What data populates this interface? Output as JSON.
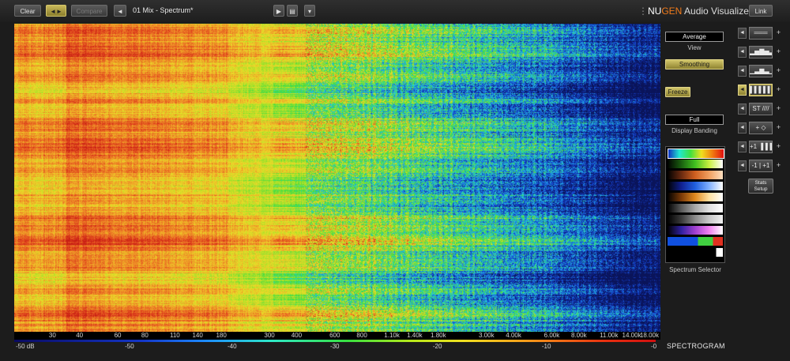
{
  "toolbar": {
    "clear_label": "Clear",
    "ab_label": "◄►",
    "compare_label": "Compare",
    "prev_label": "◄",
    "preset_name": "01 Mix - Spectrum*",
    "play_label": "▶",
    "save_label": "▤",
    "menu_label": "▾",
    "brand_nu": "NU",
    "brand_gen": "GEN",
    "brand_rest": " Audio Visualizer",
    "link_label": "Link"
  },
  "spectrogram": {
    "freq_ticks": [
      "30",
      "40",
      "60",
      "80",
      "110",
      "140",
      "180",
      "300",
      "400",
      "600",
      "800",
      "1.10k",
      "1.40k",
      "1.80k",
      "3.00k",
      "4.00k",
      "6.00k",
      "8.00k",
      "11.00k",
      "14.00k",
      "18.00k"
    ],
    "db_ticks": [
      "-50 dB",
      "-50",
      "-40",
      "-30",
      "-20",
      "-10",
      "-0"
    ],
    "mode_label": "SPECTROGRAM"
  },
  "right_panel": {
    "view_value": "Average",
    "view_caption": "View",
    "smoothing_label": "Smoothing",
    "freeze_label": "Freeze",
    "banding_value": "Full",
    "banding_caption": "Display Banding",
    "spectrum_selector_caption": "Spectrum Selector"
  },
  "side_tools": {
    "stats_label": "Stats Setup",
    "buttons": [
      {
        "icon": "═══",
        "name": "range-icon"
      },
      {
        "icon": "▂▅▇▅▃",
        "name": "spectrum-bars-icon"
      },
      {
        "icon": "▁▃▆▃▁",
        "name": "spectrum-line-icon"
      },
      {
        "icon": "▌▌▌▌▌",
        "name": "spectrogram-icon"
      },
      {
        "icon": "ST ////",
        "name": "stereo-icon"
      },
      {
        "icon": "+ ◇",
        "name": "vectorscope-icon"
      },
      {
        "icon": "+1 ▐▐▐",
        "name": "meter-icon"
      },
      {
        "icon": "-1 | +1",
        "name": "correlation-icon"
      }
    ]
  },
  "colors": {
    "accent_yellow": "#c8b85a",
    "brand_orange": "#f07a1a",
    "background": "#1c1c1c"
  }
}
